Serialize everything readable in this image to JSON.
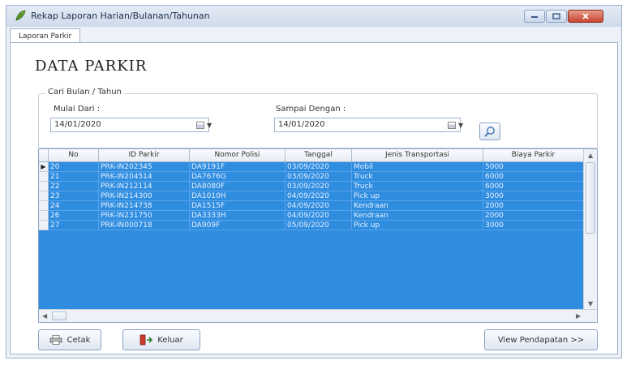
{
  "window": {
    "title": "Rekap Laporan Harian/Bulanan/Tahunan"
  },
  "tab": {
    "label": "Laporan Parkir"
  },
  "page": {
    "title": "DATA PARKIR"
  },
  "filter": {
    "group_label": "Cari Bulan / Tahun",
    "start_label": "Mulai Dari :",
    "start_value": "14/01/2020",
    "end_label": "Sampai Dengan :",
    "end_value": "14/01/2020"
  },
  "table": {
    "columns": [
      "No",
      "ID Parkir",
      "Nomor Polisi",
      "Tanggal",
      "Jenis Transportasi",
      "Biaya Parkir"
    ],
    "rows": [
      [
        "20",
        "PRK-IN202345",
        "DA9191F",
        "03/09/2020",
        "Mobil",
        "5000"
      ],
      [
        "21",
        "PRK-IN204514",
        "DA7676G",
        "03/09/2020",
        "Truck",
        "6000"
      ],
      [
        "22",
        "PRK-IN212114",
        "DA8080F",
        "03/09/2020",
        "Truck",
        "6000"
      ],
      [
        "23",
        "PRK-IN214300",
        "DA1010H",
        "04/09/2020",
        "Pick up",
        "3000"
      ],
      [
        "24",
        "PRK-IN214738",
        "DA1515F",
        "04/09/2020",
        "Kendraan",
        "2000"
      ],
      [
        "26",
        "PRK-IN231750",
        "DA3333H",
        "04/09/2020",
        "Kendraan",
        "2000"
      ],
      [
        "27",
        "PRK-IN000718",
        "DA909F",
        "05/09/2020",
        "Pick up",
        "3000"
      ]
    ]
  },
  "buttons": {
    "print": "Cetak",
    "exit": "Keluar",
    "income": "View Pendapatan >>"
  },
  "colors": {
    "grid_bg": "#2f8de0",
    "accent": "#8aa2c3"
  }
}
